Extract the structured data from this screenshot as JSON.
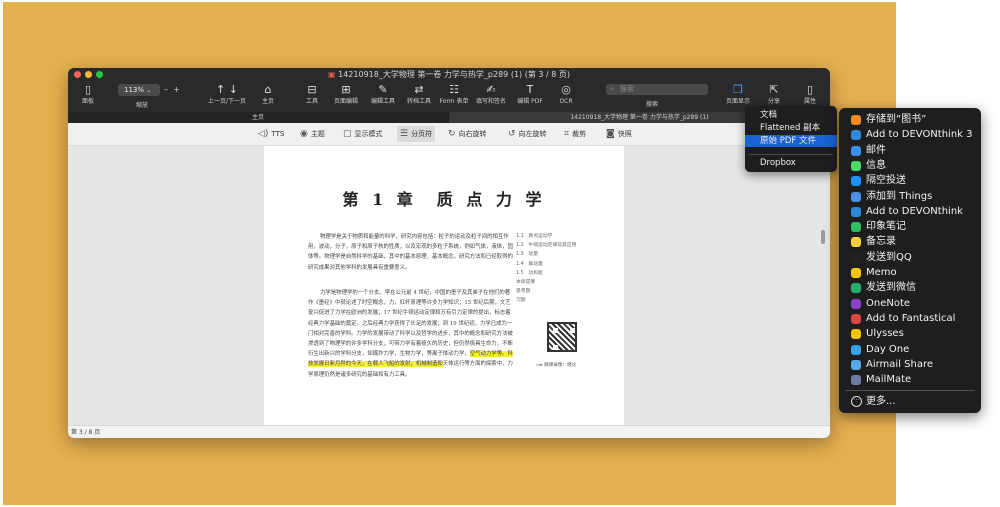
{
  "window": {
    "title": "14210918_大学物理 第一卷 力学与热学_p289 (1) (第 3 / 8 页)"
  },
  "toolbar": {
    "sidebar_label": "面板",
    "zoom_value": "113%",
    "zoom_label": "缩放",
    "zoom_minus": "–",
    "zoom_plus": "+",
    "nav_label": "上一页/下一页",
    "home_label": "主页",
    "tools_label": "工具",
    "page_edit_label": "页面编辑",
    "edit_tool_label": "编辑工具",
    "convert_label": "转档工具",
    "form_label": "Form 表单",
    "fill_sign_label": "填写和签名",
    "edit_pdf_label": "编辑 PDF",
    "ocr_label": "OCR",
    "search_placeholder": "搜索",
    "search_label": "搜索",
    "page_display_label": "页面显示",
    "share_label": "分享",
    "properties_label": "属性"
  },
  "tabs": {
    "home": "主页",
    "doc": "14210918_大学物理 第一卷 力学与热学_p289 (1)",
    "close": "×"
  },
  "subtoolbar": {
    "tts": "TTS",
    "theme": "主题",
    "display_mode": "显示模式",
    "split_page": "分页符",
    "rotate_right": "向右旋转",
    "rotate_left": "向左旋转",
    "crop": "裁剪",
    "snapshot": "快照"
  },
  "document": {
    "chapter_title": "第 1 章　质 点 力 学",
    "para1": "物理学是关于物质和能量的科学，研究内容包括：粒子的运动及粒子间的相互作用，波动，分子，原子和原子核的性质，以及宏观的多粒子系统，例如气体，液体，固体等。物理学是自然科学的基础，其中的基本原理，基本概念，研究方法和已经取得的研究成果对其他学科的发展具有重要意义。",
    "para2": "力学是物理学的一个分支。早在公元前 4 世纪，中国的墨子及其弟子在他们的著作《墨经》中就论述了时空概念，力，杠杆原理等许多力学知识；15 世纪后期，文艺复兴促进了力学在欧洲的发展；17 世纪牛顿运动定律和万有引力定律的提出，标志着经典力学基础的奠定，之后经典力学获得了长足的发展；到 19 世纪初，力学已成为一门相对完善的学科。力学的发展带动了科学以及哲学的进步，其中的概念和研究方法被渗透到了物理学的许多学科分支，可带力学有着极久的历史，但仍然极具生命力，不断衍生出新兴的学科分支，如爆炸力学，生物力学，等离子体动力学，",
    "para2_highlight": "空气动力学等。科技发展日新月异的今天，在载人飞船的发射，机械制造和",
    "para2_tail": "天体运行等方面的探索中，力学原理仍然是诸多研究的基础和有力工具。",
    "toc": [
      "1.1　质点运动学",
      "1.2　牛顿运动定律及其应用",
      "1.3　动量",
      "1.4　角动量",
      "1.5　功和能",
      "本章提要",
      "思考题",
      "习题"
    ],
    "qr_caption": "微课录像：绪论"
  },
  "status": {
    "page_info": "第 3 / 8 页"
  },
  "share_menu": {
    "items": [
      "文档",
      "Flattened 副本",
      "原始 PDF 文件",
      "Dropbox"
    ],
    "selected_index": 2
  },
  "share_extensions": {
    "items": [
      {
        "label": "存储到“图书”",
        "icon": "books-icon",
        "color": "#f08a24"
      },
      {
        "label": "Add to DEVONthink 3",
        "icon": "devonthink-icon",
        "color": "#2e8ad8"
      },
      {
        "label": "邮件",
        "icon": "mail-icon",
        "color": "#3a8ff0"
      },
      {
        "label": "信息",
        "icon": "messages-icon",
        "color": "#4cd964"
      },
      {
        "label": "隔空投送",
        "icon": "airdrop-icon",
        "color": "#1e90ff"
      },
      {
        "label": "添加到 Things",
        "icon": "things-icon",
        "color": "#4a90e2"
      },
      {
        "label": "Add to DEVONthink",
        "icon": "devonthink-icon",
        "color": "#2e8ad8"
      },
      {
        "label": "印象笔记",
        "icon": "evernote-icon",
        "color": "#2dbe60"
      },
      {
        "label": "备忘录",
        "icon": "notes-icon",
        "color": "#f5d33f"
      },
      {
        "label": "发送到QQ",
        "icon": "qq-icon",
        "color": "#222222"
      },
      {
        "label": "Memo",
        "icon": "memo-icon",
        "color": "#f7c514"
      },
      {
        "label": "发送到微信",
        "icon": "wechat-icon",
        "color": "#2aae67"
      },
      {
        "label": "OneNote",
        "icon": "onenote-icon",
        "color": "#8b3fc7"
      },
      {
        "label": "Add to Fantastical",
        "icon": "fantastical-icon",
        "color": "#d9453f"
      },
      {
        "label": "Ulysses",
        "icon": "ulysses-icon",
        "color": "#f2c200"
      },
      {
        "label": "Day One",
        "icon": "dayone-icon",
        "color": "#3da3e8"
      },
      {
        "label": "Airmail Share",
        "icon": "airmail-icon",
        "color": "#5aa8e6"
      },
      {
        "label": "MailMate",
        "icon": "mailmate-icon",
        "color": "#6f7fa3"
      }
    ],
    "more_label": "更多..."
  }
}
